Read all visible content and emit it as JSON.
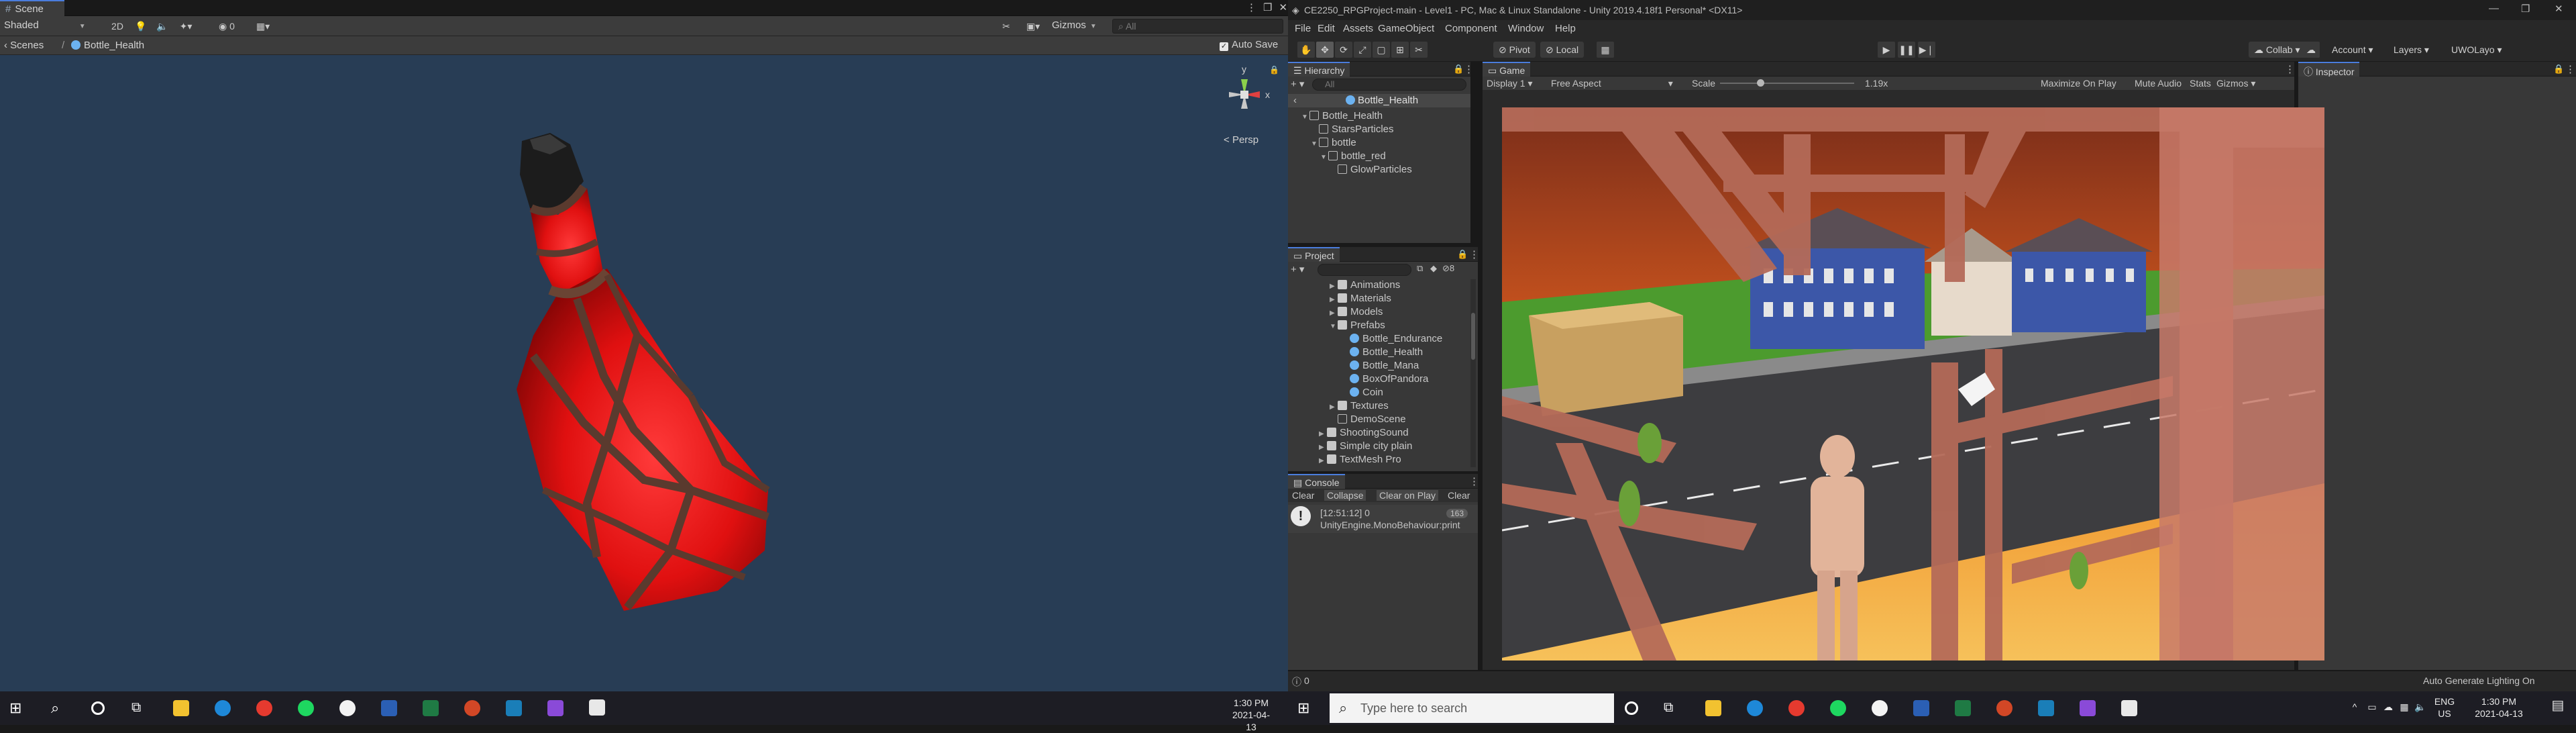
{
  "scene": {
    "tab_label": "Scene",
    "shading": "Shaded",
    "mode_2d": "2D",
    "overlay_count": "0",
    "gizmos": "Gizmos",
    "search_placeholder": "All",
    "breadcrumb_root": "Scenes",
    "breadcrumb_current": "Bottle_Health",
    "auto_save": "Auto Save",
    "projection": "Persp",
    "gizmo_axes": {
      "y": "y",
      "x": "x"
    }
  },
  "editor": {
    "title": "CE2250_RPGProject-main - Level1 - PC, Mac & Linux Standalone - Unity 2019.4.18f1 Personal* <DX11>",
    "menu": [
      "File",
      "Edit",
      "Assets",
      "GameObject",
      "Component",
      "Window",
      "Help"
    ],
    "toolbar": {
      "pivot": "Pivot",
      "local": "Local",
      "collab": "Collab",
      "account": "Account",
      "layers": "Layers",
      "layout": "UWOLayo"
    }
  },
  "hierarchy": {
    "tab": "Hierarchy",
    "search_placeholder": "All",
    "prefab_header": "Bottle_Health",
    "items": [
      {
        "label": "Bottle_Health"
      },
      {
        "label": "StarsParticles"
      },
      {
        "label": "bottle"
      },
      {
        "label": "bottle_red"
      },
      {
        "label": "GlowParticles"
      }
    ]
  },
  "project": {
    "tab": "Project",
    "hidden_count": "8",
    "items": [
      {
        "label": "Animations"
      },
      {
        "label": "Materials"
      },
      {
        "label": "Models"
      },
      {
        "label": "Prefabs"
      },
      {
        "label": "Bottle_Endurance"
      },
      {
        "label": "Bottle_Health"
      },
      {
        "label": "Bottle_Mana"
      },
      {
        "label": "BoxOfPandora"
      },
      {
        "label": "Coin"
      },
      {
        "label": "Textures"
      },
      {
        "label": "DemoScene"
      },
      {
        "label": "ShootingSound"
      },
      {
        "label": "Simple city plain"
      },
      {
        "label": "TextMesh Pro"
      }
    ]
  },
  "console": {
    "tab": "Console",
    "buttons": [
      "Clear",
      "Collapse",
      "Clear on Play",
      "Clear"
    ],
    "log_time": "[12:51:12] 0",
    "log_source": "UnityEngine.MonoBehaviour:print",
    "log_count": "163"
  },
  "game": {
    "tab": "Game",
    "display": "Display 1",
    "aspect": "Free Aspect",
    "scale_label": "Scale",
    "scale_value": "1.19x",
    "scale_fraction": 0.3,
    "maximize": "Maximize On Play",
    "mute": "Mute Audio",
    "stats": "Stats",
    "gizmos": "Gizmos"
  },
  "inspector": {
    "tab": "Inspector"
  },
  "status": {
    "left_count": "0",
    "lighting": "Auto Generate Lighting On"
  },
  "taskbar": {
    "left_time": "1:30 PM",
    "left_date": "2021-04-13",
    "search_placeholder": "Type here to search",
    "lang": "ENG",
    "region": "US",
    "right_time": "1:30 PM",
    "right_date": "2021-04-13"
  },
  "colors": {
    "accent": "#4a7ddd",
    "bottle_red": "#e11d1d",
    "scene_bg": "#283d55"
  }
}
